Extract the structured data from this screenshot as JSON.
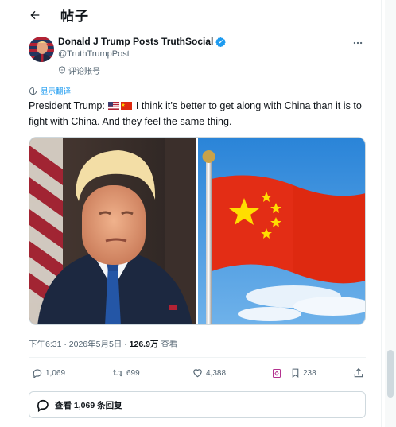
{
  "header": {
    "title": "帖子"
  },
  "post": {
    "author": {
      "display_name": "Donald J Trump Posts TruthSocial",
      "handle": "@TruthTrumpPost",
      "affiliation": "评论账号"
    },
    "translate_label": "显示翻译",
    "text_prefix": "President Trump:",
    "text_body": "I think it’s better to get along with China than it is to fight with China. And they feel the same thing.",
    "emoji_flags": [
      "us-flag",
      "china-flag"
    ],
    "timestamp": "下午6:31 · 2026年5月5日 · ",
    "views_count": "126.9万",
    "views_label": " 查看",
    "actions": {
      "reply_count": "1,069",
      "repost_count": "699",
      "like_count": "4,388",
      "bookmark_count": "238"
    },
    "view_replies_label": "查看 1,069 条回复"
  },
  "colors": {
    "accent": "#1d9bf0",
    "text": "#0f1419",
    "secondary": "#536471",
    "china_red": "#de2910",
    "china_yellow": "#ffde00"
  }
}
